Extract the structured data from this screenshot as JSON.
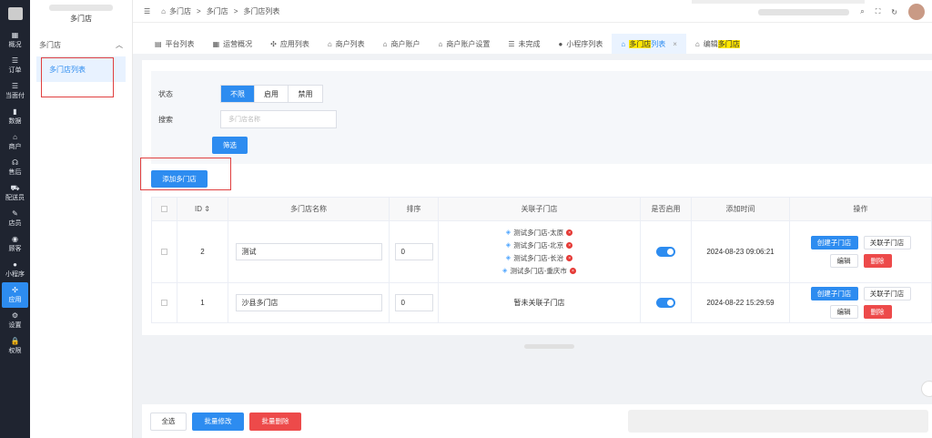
{
  "leftnav": [
    {
      "icon": "▦",
      "label": "概况"
    },
    {
      "icon": "☰",
      "label": "订单"
    },
    {
      "icon": "☰",
      "label": "当面付"
    },
    {
      "icon": "▮",
      "label": "数据"
    },
    {
      "icon": "⌂",
      "label": "商户"
    },
    {
      "icon": "☊",
      "label": "售后"
    },
    {
      "icon": "⛟",
      "label": "配送员"
    },
    {
      "icon": "✎",
      "label": "店员"
    },
    {
      "icon": "◉",
      "label": "顾客"
    },
    {
      "icon": "●",
      "label": "小程序"
    },
    {
      "icon": "✣",
      "label": "应用"
    },
    {
      "icon": "⚙",
      "label": "设置"
    },
    {
      "icon": "🔒",
      "label": "权限"
    }
  ],
  "submenu": {
    "brand": "多门店",
    "group": "多门店",
    "item": "多门店列表"
  },
  "breadcrumb": [
    "多门店",
    ">",
    "多门店",
    ">",
    "多门店列表"
  ],
  "tabs": [
    {
      "label": "平台列表"
    },
    {
      "label": "运营概况"
    },
    {
      "label": "应用列表"
    },
    {
      "label": "商户列表"
    },
    {
      "label": "商户账户"
    },
    {
      "label": "商户账户设置"
    },
    {
      "label": "未完成"
    },
    {
      "label": "小程序列表"
    },
    {
      "label_prefix": "",
      "label_hl": "多门店",
      "label_suffix": "列表"
    },
    {
      "label_prefix": "编辑",
      "label_hl": "多门店",
      "label_suffix": ""
    }
  ],
  "filter": {
    "status_label": "状态",
    "status_options": [
      "不限",
      "启用",
      "禁用"
    ],
    "search_label": "搜索",
    "search_placeholder": "多门店名称",
    "filter_button": "筛选"
  },
  "add_button": "添加多门店",
  "table": {
    "headers": [
      "ID ⇕",
      "多门店名称",
      "排序",
      "关联子门店",
      "是否启用",
      "添加时间",
      "操作"
    ],
    "rows": [
      {
        "id": "2",
        "name": "测试",
        "sort": "0",
        "shops": [
          "测试多门店-太原",
          "测试多门店-北京",
          "测试多门店-长治",
          "测试多门店-重庆市"
        ],
        "enabled": true,
        "time": "2024-08-23 09:06:21"
      },
      {
        "id": "1",
        "name": "沙县多门店",
        "sort": "0",
        "shops": [],
        "no_shop_text": "暂未关联子门店",
        "enabled": true,
        "time": "2024-08-22 15:29:59"
      }
    ],
    "ops": {
      "create": "创建子门店",
      "link": "关联子门店",
      "edit": "编辑",
      "delete": "删除"
    }
  },
  "footer": {
    "select_all": "全选",
    "batch_edit": "批量修改",
    "batch_delete": "批量删除"
  }
}
